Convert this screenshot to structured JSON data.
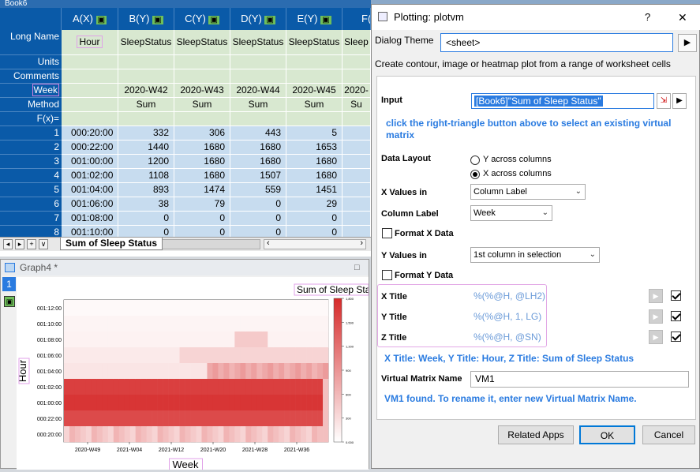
{
  "sheet": {
    "title": "Book6",
    "columns": [
      "A(X)",
      "B(Y)",
      "C(Y)",
      "D(Y)",
      "E(Y)",
      "F("
    ],
    "row_headers": {
      "long_name": "Long Name",
      "units": "Units",
      "comments": "Comments",
      "week": "Week",
      "method": "Method",
      "fx": "F(x)="
    },
    "long_names": [
      "Hour",
      "SleepStatus",
      "SleepStatus",
      "SleepStatus",
      "SleepStatus",
      "Sleep"
    ],
    "weeks": [
      "",
      "2020-W42",
      "2020-W43",
      "2020-W44",
      "2020-W45",
      "2020-"
    ],
    "methods": [
      "",
      "Sum",
      "Sum",
      "Sum",
      "Sum",
      "Su"
    ],
    "rows": [
      {
        "n": "1",
        "a": "000:20:00",
        "b": "332",
        "c": "306",
        "d": "443",
        "e": "5"
      },
      {
        "n": "2",
        "a": "000:22:00",
        "b": "1440",
        "c": "1680",
        "d": "1680",
        "e": "1653"
      },
      {
        "n": "3",
        "a": "001:00:00",
        "b": "1200",
        "c": "1680",
        "d": "1680",
        "e": "1680"
      },
      {
        "n": "4",
        "a": "001:02:00",
        "b": "1108",
        "c": "1680",
        "d": "1507",
        "e": "1680"
      },
      {
        "n": "5",
        "a": "001:04:00",
        "b": "893",
        "c": "1474",
        "d": "559",
        "e": "1451"
      },
      {
        "n": "6",
        "a": "001:06:00",
        "b": "38",
        "c": "79",
        "d": "0",
        "e": "29"
      },
      {
        "n": "7",
        "a": "001:08:00",
        "b": "0",
        "c": "0",
        "d": "0",
        "e": "0"
      },
      {
        "n": "8",
        "a": "001:10:00",
        "b": "0",
        "c": "0",
        "d": "0",
        "e": "0"
      }
    ],
    "tab": "Sum of Sleep Status"
  },
  "graph": {
    "window_title": "Graph4 *",
    "layer": "1",
    "plot_title": "Sum of Sleep Statu",
    "xlabel": "Week",
    "ylabel": "Hour",
    "yticks": [
      "001:12:00",
      "001:10:00",
      "001:08:00",
      "001:06:00",
      "001:04:00",
      "001:02:00",
      "001:00:00",
      "000:22:00",
      "000:20:00"
    ],
    "xticks": [
      "2020-W49",
      "2021-W04",
      "2021-W12",
      "2021-W20",
      "2021-W28",
      "2021-W36"
    ],
    "colorbar_ticks": [
      "1,800",
      "1,500",
      "1,200",
      "900",
      "600",
      "300",
      "0.000"
    ]
  },
  "chart_data": {
    "type": "heatmap",
    "title": "Sum of Sleep Statu",
    "xlabel": "Week",
    "ylabel": "Hour",
    "x_categories": [
      "2020-W49",
      "2021-W04",
      "2021-W12",
      "2021-W20",
      "2021-W28",
      "2021-W36"
    ],
    "y_categories": [
      "000:20:00",
      "000:22:00",
      "001:00:00",
      "001:02:00",
      "001:04:00",
      "001:06:00",
      "001:08:00",
      "001:10:00",
      "001:12:00"
    ],
    "z_range": [
      0,
      1800
    ],
    "colors": {
      "low": "#ffffff",
      "high": "#d62a2a"
    }
  },
  "dialog": {
    "title": "Plotting: plotvm",
    "help": "?",
    "close": "✕",
    "theme_label": "Dialog Theme",
    "theme_value": "<sheet>",
    "description": "Create contour, image or heatmap plot from a range of worksheet cells",
    "input_label": "Input",
    "input_value": "[Book6]\"Sum of Sleep Status\"",
    "hint": "click the right-triangle button above to select an existing virtual matrix",
    "data_layout_label": "Data Layout",
    "layout_opt1": "Y across columns",
    "layout_opt2": "X across columns",
    "x_values_label": "X Values in",
    "x_values_value": "Column Label",
    "column_label_label": "Column Label",
    "column_label_value": "Week",
    "format_x_label": "Format X Data",
    "y_values_label": "Y Values in",
    "y_values_value": "1st column in selection",
    "format_y_label": "Format Y Data",
    "x_title_label": "X Title",
    "x_title_value": "%(%@H, @LH2)",
    "y_title_label": "Y Title",
    "y_title_value": "%(%@H, 1, LG)",
    "z_title_label": "Z Title",
    "z_title_value": "%(%@H, @SN)",
    "titles_summary": "X Title: Week, Y Title: Hour, Z Title: Sum of Sleep Status",
    "vm_name_label": "Virtual Matrix Name",
    "vm_name_value": "VM1",
    "vm_status": "VM1 found. To rename it, enter new Virtual Matrix Name.",
    "related_apps": "Related Apps",
    "ok": "OK",
    "cancel": "Cancel"
  }
}
